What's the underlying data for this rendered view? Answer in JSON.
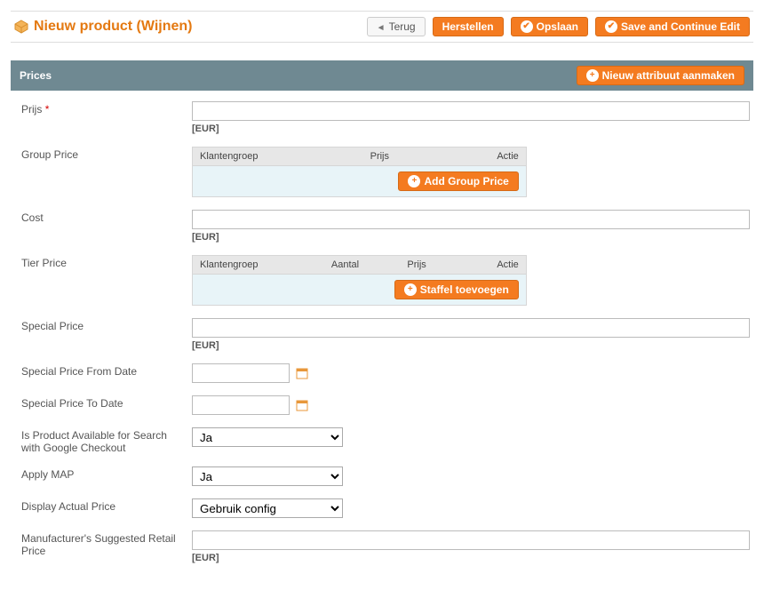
{
  "header": {
    "title": "Nieuw product (Wijnen)",
    "back_label": "Terug",
    "reset_label": "Herstellen",
    "save_label": "Opslaan",
    "save_continue_label": "Save and Continue Edit"
  },
  "section": {
    "title": "Prices",
    "new_attr_label": "Nieuw attribuut aanmaken"
  },
  "currency_hint": "[EUR]",
  "group_price": {
    "col_group": "Klantengroep",
    "col_price": "Prijs",
    "col_action": "Actie",
    "add_label": "Add Group Price"
  },
  "tier_price": {
    "col_group": "Klantengroep",
    "col_qty": "Aantal",
    "col_price": "Prijs",
    "col_action": "Actie",
    "add_label": "Staffel toevoegen"
  },
  "fields": {
    "price": "Prijs",
    "group_price": "Group Price",
    "cost": "Cost",
    "tier_price": "Tier Price",
    "special_price": "Special Price",
    "special_from": "Special Price From Date",
    "special_to": "Special Price To Date",
    "google_checkout": "Is Product Available for Search with Google Checkout",
    "apply_map": "Apply MAP",
    "display_actual": "Display Actual Price",
    "msrp": "Manufacturer's Suggested Retail Price"
  },
  "selects": {
    "google_checkout_value": "Ja",
    "apply_map_value": "Ja",
    "display_actual_value": "Gebruik config"
  }
}
